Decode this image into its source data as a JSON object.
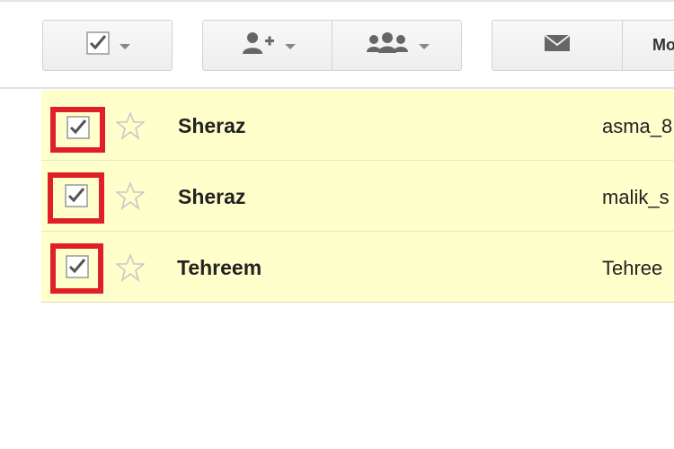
{
  "toolbar": {
    "more_label": "Mo"
  },
  "icons": {
    "select": "checkbox-icon",
    "add_person": "person-add-icon",
    "group": "group-icon",
    "mail": "mail-icon"
  },
  "colors": {
    "row_highlight": "#ffffcc",
    "selection_frame": "#e01f26"
  },
  "rows": [
    {
      "sender": "Sheraz",
      "subject": "asma_8",
      "checked": true,
      "starred": false
    },
    {
      "sender": "Sheraz",
      "subject": "malik_s",
      "checked": true,
      "starred": false
    },
    {
      "sender": "Tehreem",
      "subject": "Tehree",
      "checked": true,
      "starred": false
    }
  ]
}
